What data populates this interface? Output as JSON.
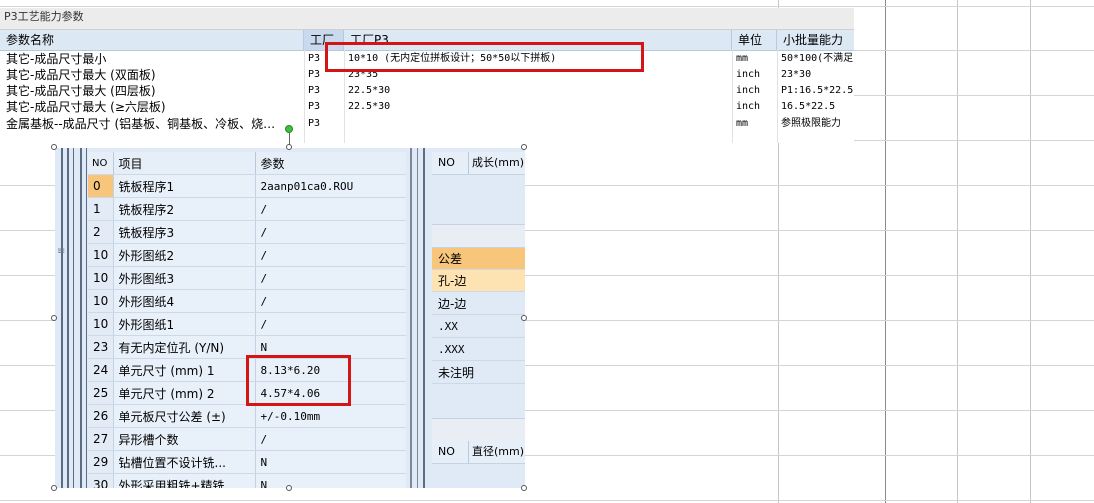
{
  "top_table": {
    "title": "P3工艺能力参数",
    "headers": {
      "name": "参数名称",
      "process": "工厂",
      "value": "工厂P3",
      "unit": "单位",
      "capacity": "小批量能力"
    },
    "rows": [
      {
        "name": "其它-成品尺寸最小",
        "process": "P3",
        "value": "10*10 (无内定位拼板设计；50*50以下拼板)",
        "unit": "mm",
        "capacity": "50*100(不满足"
      },
      {
        "name": "其它-成品尺寸最大 (双面板)",
        "process": "P3",
        "value": "23*35",
        "unit": "inch",
        "capacity": "23*30"
      },
      {
        "name": "其它-成品尺寸最大 (四层板)",
        "process": "P3",
        "value": "22.5*30",
        "unit": "inch",
        "capacity": "P1:16.5*22.5"
      },
      {
        "name": "其它-成品尺寸最大 (≥六层板)",
        "process": "P3",
        "value": "22.5*30",
        "unit": "inch",
        "capacity": "16.5*22.5"
      },
      {
        "name": "金属基板--成品尺寸 (铝基板、铜基板、冷板、烧…",
        "process": "P3",
        "value": "",
        "unit": "mm",
        "capacity": "参照极限能力"
      }
    ]
  },
  "panel": {
    "grid_headers": {
      "no": "NO",
      "item": "项目",
      "param": "参数"
    },
    "rows": [
      {
        "no": "0",
        "item": "铣板程序1",
        "param": "2aanp01ca0.ROU"
      },
      {
        "no": "1",
        "item": "铣板程序2",
        "param": "/"
      },
      {
        "no": "2",
        "item": "铣板程序3",
        "param": "/"
      },
      {
        "no": "10",
        "item": "外形图纸2",
        "param": "/"
      },
      {
        "no": "10",
        "item": "外形图纸3",
        "param": "/"
      },
      {
        "no": "10",
        "item": "外形图纸4",
        "param": "/"
      },
      {
        "no": "10",
        "item": "外形图纸1",
        "param": "/"
      },
      {
        "no": "23",
        "item": "有无内定位孔 (Y/N)",
        "param": "N"
      },
      {
        "no": "24",
        "item": "单元尺寸 (mm) 1",
        "param": "8.13*6.20"
      },
      {
        "no": "25",
        "item": "单元尺寸 (mm) 2",
        "param": "4.57*4.06"
      },
      {
        "no": "26",
        "item": "单元板尺寸公差 (±)",
        "param": "+/-0.10mm"
      },
      {
        "no": "27",
        "item": "异形槽个数",
        "param": "/"
      },
      {
        "no": "29",
        "item": "钻槽位置不设计铣...",
        "param": "N"
      },
      {
        "no": "30",
        "item": "外形采用粗铣+精铣...",
        "param": "N"
      }
    ],
    "right_top_headers": {
      "no": "NO",
      "label": "成长(mm)"
    },
    "tolerance": {
      "header": "公差",
      "items": [
        "孔-边",
        "边-边",
        ".XX",
        ".XXX",
        "未注明"
      ]
    },
    "right_bottom_headers": {
      "no": "NO",
      "label": "直径(mm)"
    }
  },
  "colors": {
    "highlight_red": "#d41515",
    "selected_orange": "#f7c67a",
    "panel_blue": "#dfeaf6"
  }
}
